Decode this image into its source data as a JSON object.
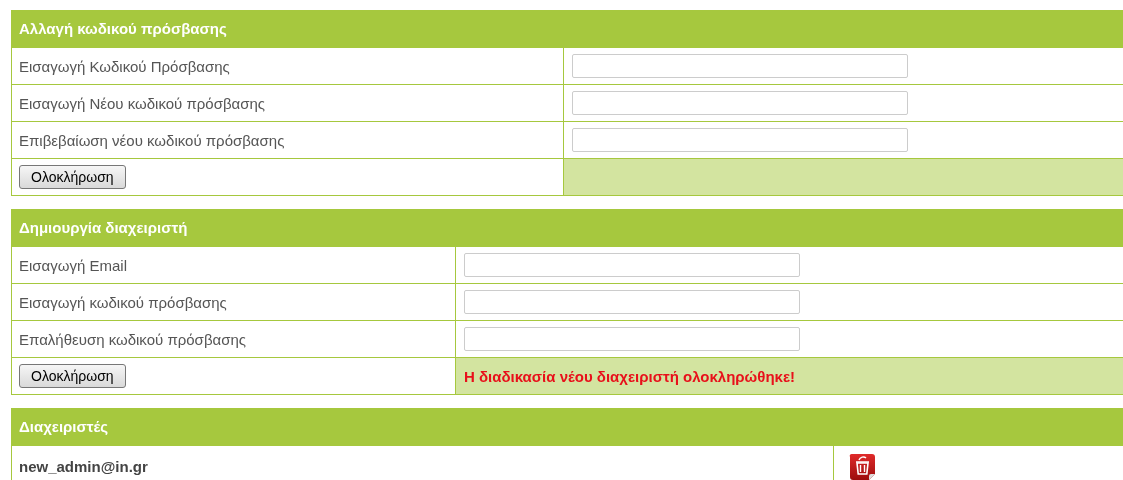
{
  "sections": [
    {
      "kind": "form",
      "title": "Αλλαγή κωδικού πρόσβασης",
      "rows": [
        {
          "label": "Εισαγωγή Κωδικού Πρόσβασης"
        },
        {
          "label": "Εισαγωγή Νέου κωδικού πρόσβασης"
        },
        {
          "label": "Επιβεβαίωση νέου κωδικού πρόσβασης"
        }
      ],
      "button": "Ολοκλήρωση"
    },
    {
      "kind": "form",
      "title": "Δημιουργία διαχειριστή",
      "rows": [
        {
          "label": "Εισαγωγή Email"
        },
        {
          "label": "Εισαγωγή κωδικού πρόσβασης"
        },
        {
          "label": "Επαλήθευση κωδικού πρόσβασης"
        }
      ],
      "button": "Ολοκλήρωση",
      "message": "Η διαδικασία νέου διαχειριστή ολοκληρώθηκε!"
    },
    {
      "kind": "list",
      "title": "Διαχειριστές",
      "rows": [
        {
          "email": "new_admin@in.gr"
        }
      ]
    }
  ]
}
